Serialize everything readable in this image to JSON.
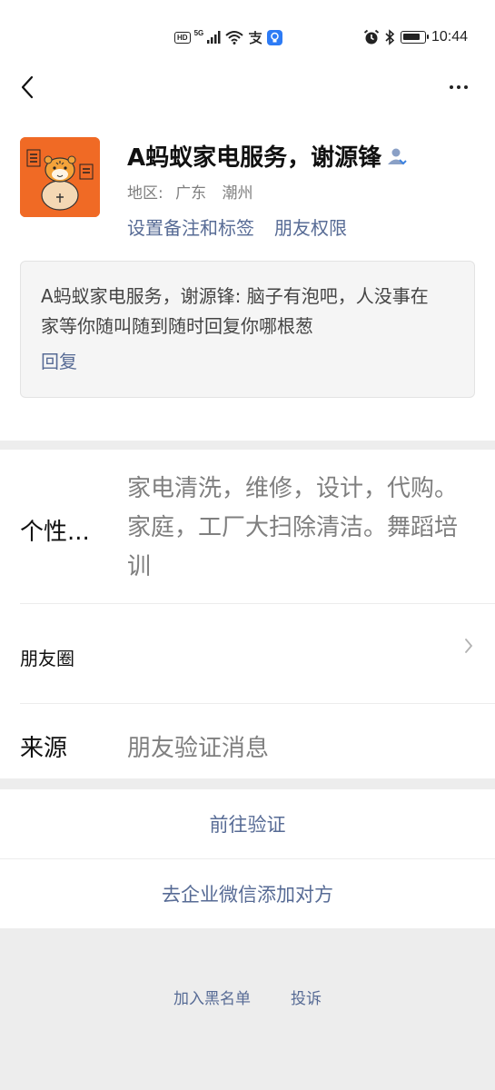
{
  "status_bar": {
    "hd": "HD",
    "network": "5G",
    "time": "10:44"
  },
  "profile": {
    "name": "A蚂蚁家电服务，谢源锋",
    "region_label": "地区:",
    "region_province": "广东",
    "region_city": "潮州",
    "actions": {
      "remark": "设置备注和标签",
      "permission": "朋友权限"
    },
    "moment": {
      "text": "A蚂蚁家电服务，谢源锋: 脑子有泡吧，人没事在家等你随叫随到随时回复你哪根葱",
      "reply": "回复"
    }
  },
  "info": {
    "signature_label": "个性...",
    "signature_value": "家电清洗，维修，设计，代购。家庭，工厂大扫除清洁。舞蹈培训",
    "moments_label": "朋友圈",
    "source_label": "来源",
    "source_value": "朋友验证消息"
  },
  "buttons": {
    "verify": "前往验证",
    "wecom_add": "去企业微信添加对方"
  },
  "footer": {
    "blacklist": "加入黑名单",
    "report": "投诉"
  },
  "colors": {
    "link": "#576b95",
    "avatar_bg": "#f06a25",
    "page_bg": "#ededed"
  }
}
